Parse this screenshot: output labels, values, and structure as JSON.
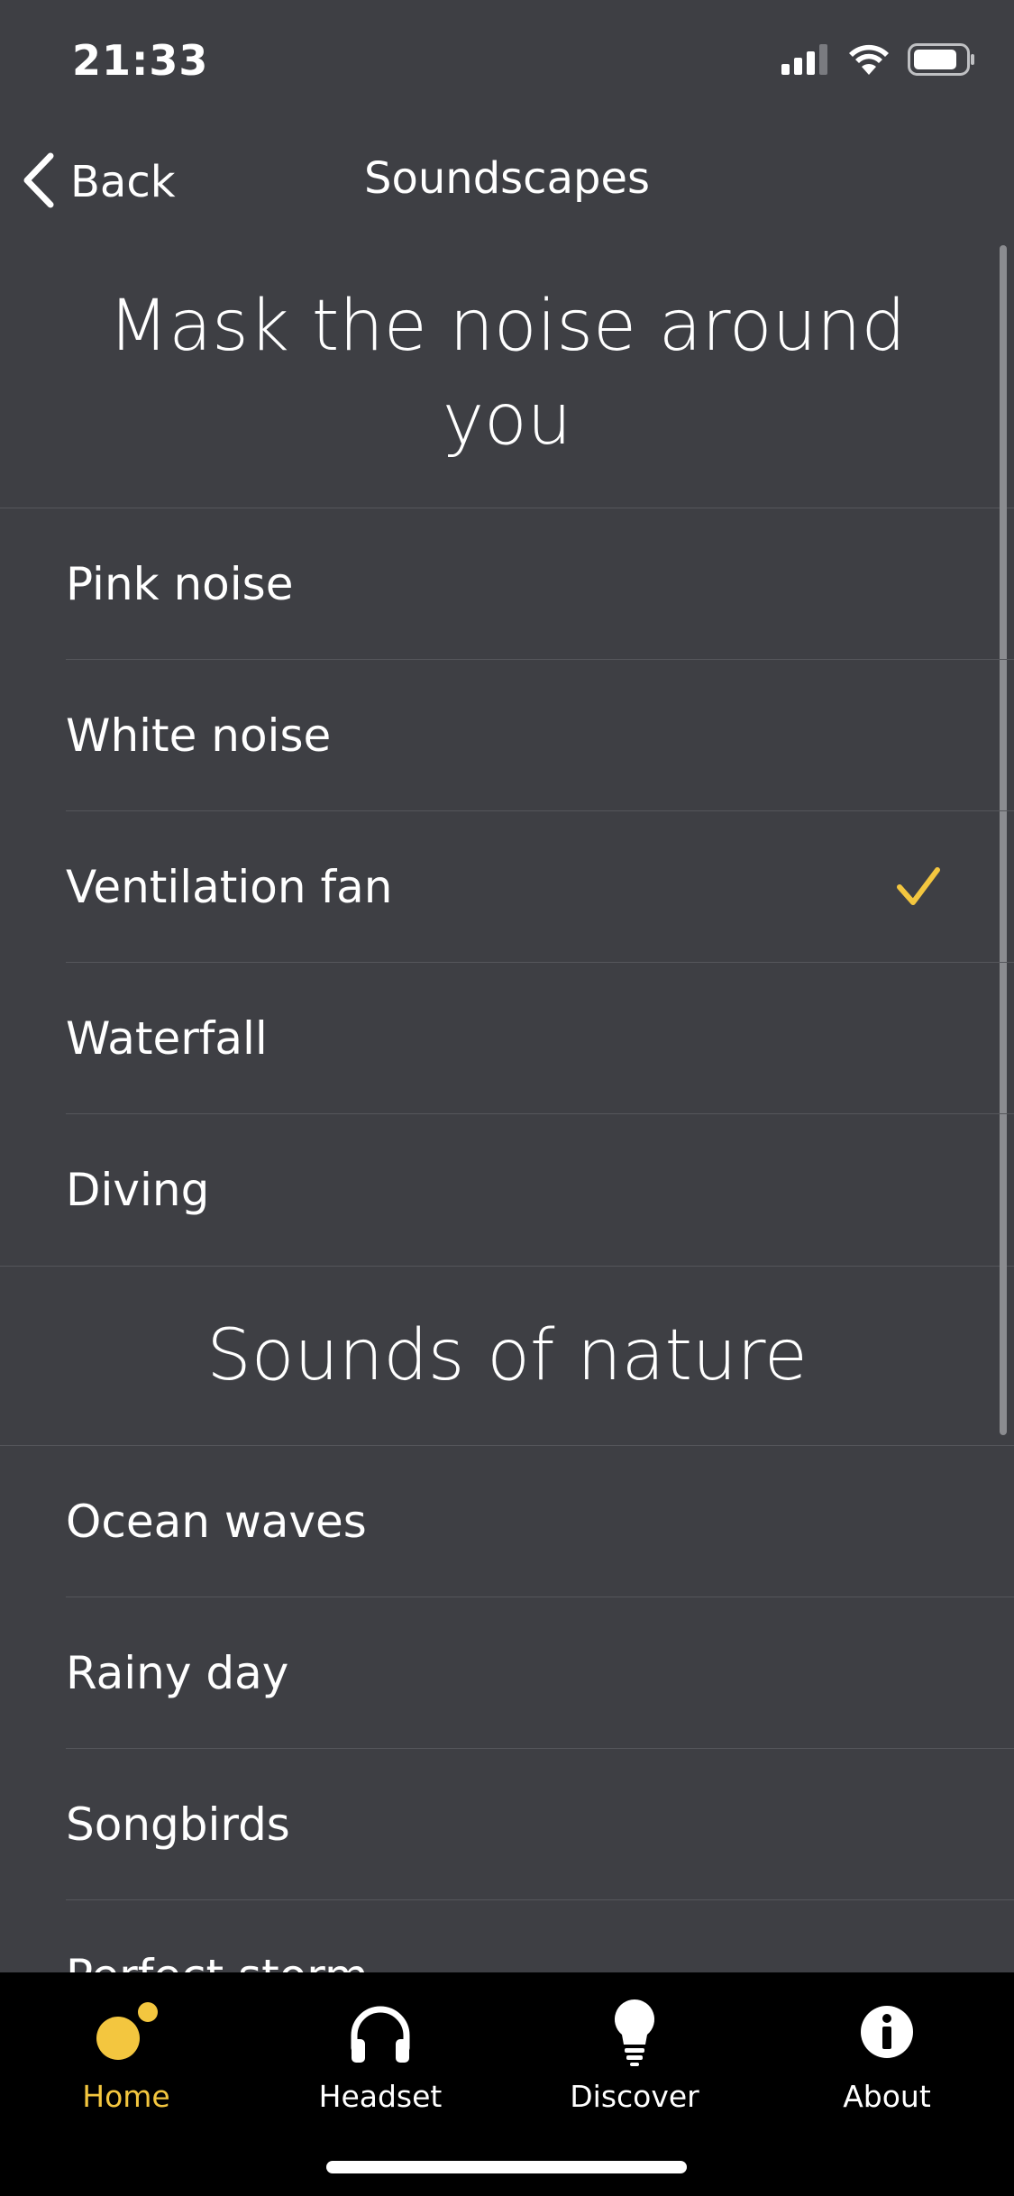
{
  "status_bar": {
    "time": "21:33",
    "icons": [
      "signal-icon",
      "wifi-icon",
      "battery-icon"
    ]
  },
  "nav": {
    "back_label": "Back",
    "title": "Soundscapes"
  },
  "sections": [
    {
      "title": "Mask the noise around you",
      "items": [
        {
          "label": "Pink noise",
          "selected": false
        },
        {
          "label": "White noise",
          "selected": false
        },
        {
          "label": "Ventilation fan",
          "selected": true
        },
        {
          "label": "Waterfall",
          "selected": false
        },
        {
          "label": "Diving",
          "selected": false
        }
      ]
    },
    {
      "title": "Sounds of nature",
      "items": [
        {
          "label": "Ocean waves",
          "selected": false
        },
        {
          "label": "Rainy day",
          "selected": false
        },
        {
          "label": "Songbirds",
          "selected": false
        },
        {
          "label": "Perfect storm",
          "selected": false
        }
      ]
    }
  ],
  "tab_bar": {
    "active": "Home",
    "tabs": [
      {
        "label": "Home",
        "icon": "home-dots-icon"
      },
      {
        "label": "Headset",
        "icon": "headphones-icon"
      },
      {
        "label": "Discover",
        "icon": "lightbulb-icon"
      },
      {
        "label": "About",
        "icon": "info-icon"
      }
    ]
  },
  "colors": {
    "background": "#3e3f44",
    "accent": "#f3c63f",
    "tab_bar_background": "#000000",
    "separator": "#55565b"
  }
}
